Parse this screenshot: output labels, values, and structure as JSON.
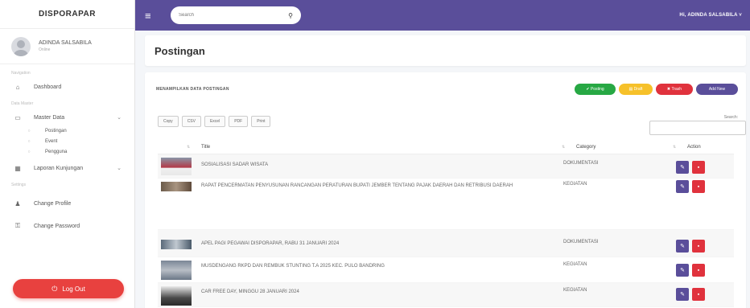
{
  "app": {
    "brand": "DISPORAPAR"
  },
  "sidebar": {
    "user": {
      "name": "ADINDA SALSABILA",
      "status": "Online"
    },
    "sections": [
      {
        "header": "Navigation"
      },
      {
        "header": "Data Master"
      },
      {
        "header": "Settings"
      }
    ],
    "items": {
      "dashboard": "Dashboard",
      "master_data": "Master Data",
      "postingan": "Postingan",
      "event": "Event",
      "pengguna": "Pengguna",
      "laporan": "Laporan Kunjungan",
      "change_profile": "Change Profile",
      "change_password": "Change Password"
    },
    "logout": "Log Out"
  },
  "topbar": {
    "search_placeholder": "Search",
    "user": "Hi, ADINDA SALSABILA"
  },
  "page": {
    "title": "Postingan"
  },
  "card": {
    "heading": "MENAMPILKAN DATA POSTINGAN",
    "pills": {
      "posting": "Posting",
      "draft": "Draft",
      "trash": "Trash",
      "add_new": "Add New"
    },
    "exports": [
      "Copy",
      "CSV",
      "Excel",
      "PDF",
      "Print"
    ],
    "search_label": "Search:"
  },
  "table": {
    "columns": {
      "title": "Title",
      "category": "Category",
      "action": "Action"
    },
    "rows": [
      {
        "title": "SOSIALISASI SADAR WISATA",
        "category": "DOKUMENTASI"
      },
      {
        "title": "RAPAT PENCERMATAN PENYUSUNAN RANCANGAN PERATURAN BUPATI JEMBER TENTANG PAJAK DAERAH DAN RETRIBUSI DAERAH",
        "category": "KEGIATAN"
      },
      {
        "title": "APEL PAGI PEGAWAI DISPORAPAR, RABU 31 JANUARI 2024",
        "category": "DOKUMENTASI"
      },
      {
        "title": "MUSDENGANG RKPD DAN REMBUK STUNTING T.A 2025 KEC. PULO BANDRING",
        "category": "KEGIATAN"
      },
      {
        "title": "CAR FREE DAY, MINGGU 28 JANUARI 2024",
        "category": "KEGIATAN"
      }
    ]
  }
}
